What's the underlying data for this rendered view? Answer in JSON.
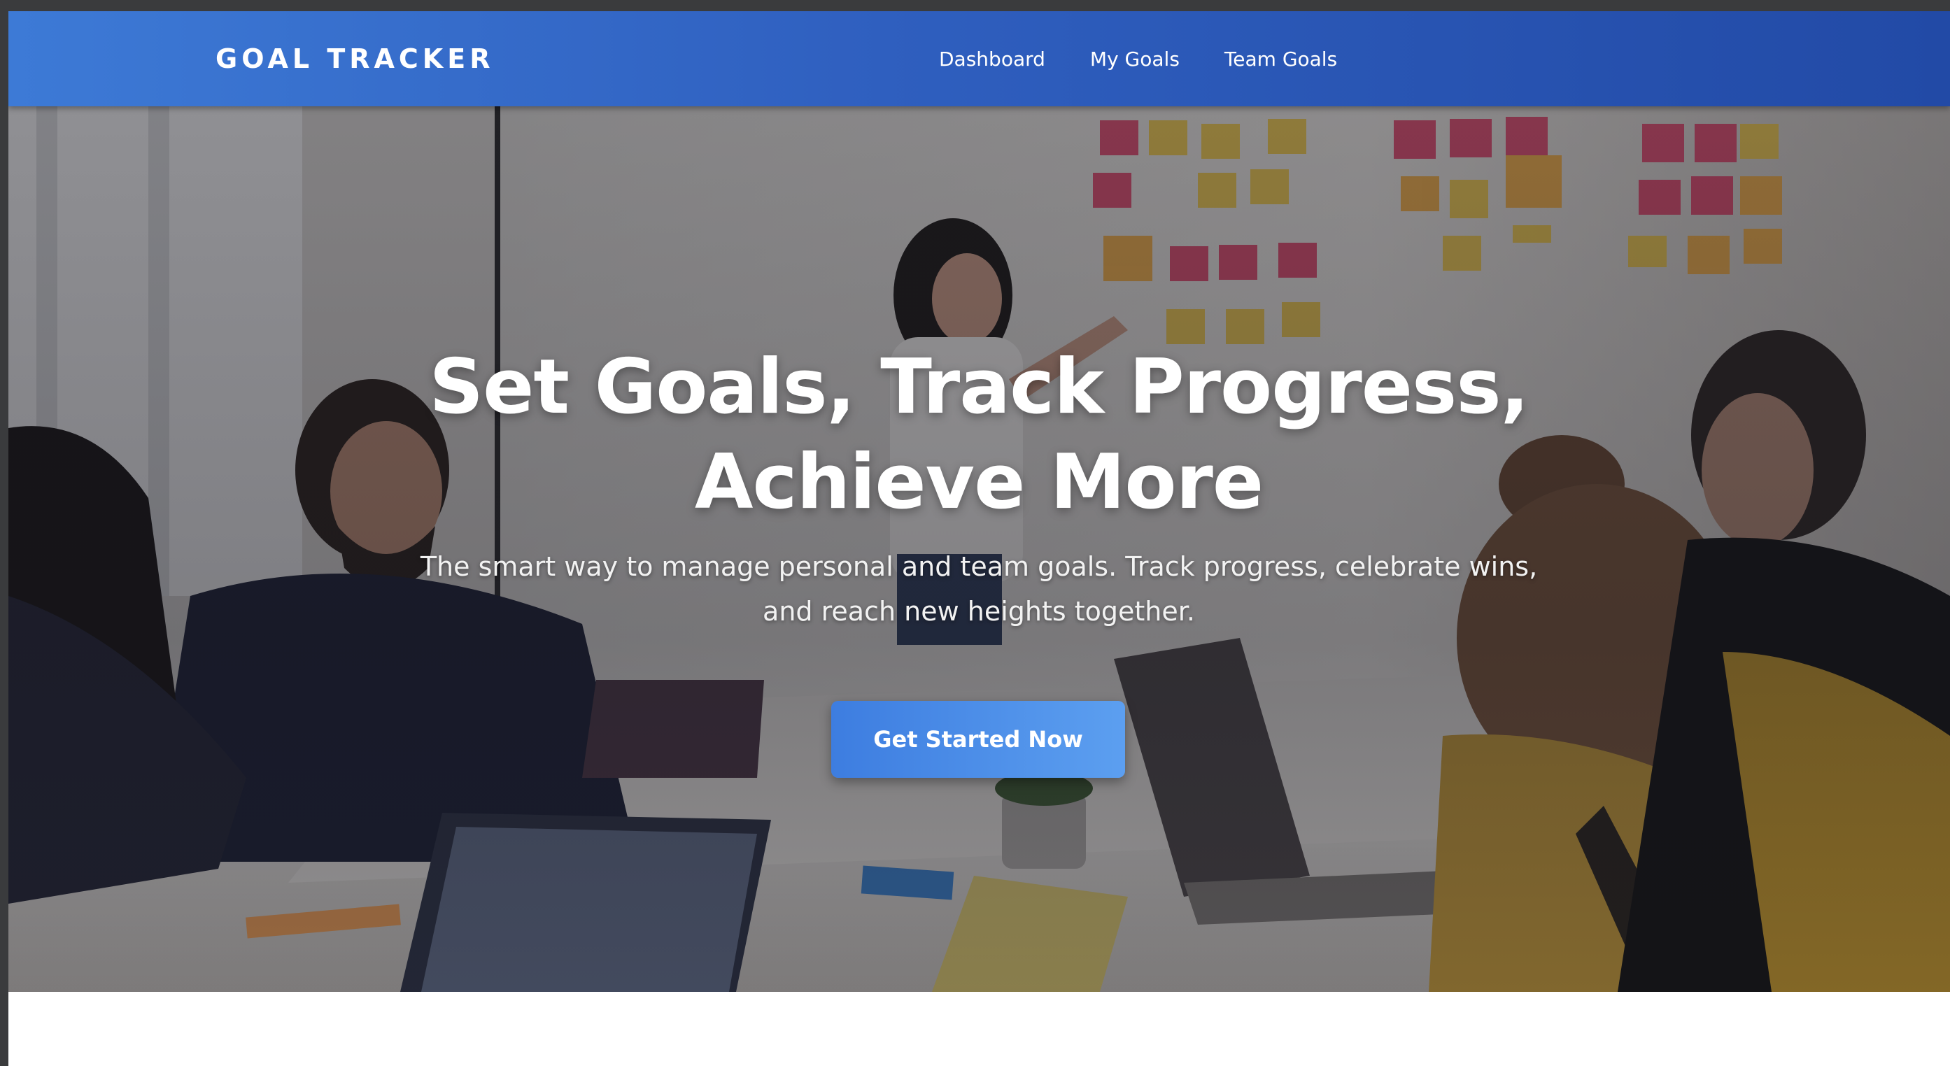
{
  "navbar": {
    "brand": "GOAL TRACKER",
    "links": [
      {
        "label": "Dashboard"
      },
      {
        "label": "My Goals"
      },
      {
        "label": "Team Goals"
      }
    ]
  },
  "hero": {
    "title_line1": "Set Goals, Track Progress,",
    "title_line2": "Achieve More",
    "subtitle": "The smart way to manage personal and team goals. Track progress, celebrate wins, and reach new heights together.",
    "cta_label": "Get Started Now",
    "image": "team-meeting-photo"
  },
  "colors": {
    "nav_start": "#3d7ad6",
    "nav_end": "#224aa6",
    "cta_start": "#3d7de0",
    "cta_end": "#5c9ff0",
    "text": "#ffffff"
  }
}
